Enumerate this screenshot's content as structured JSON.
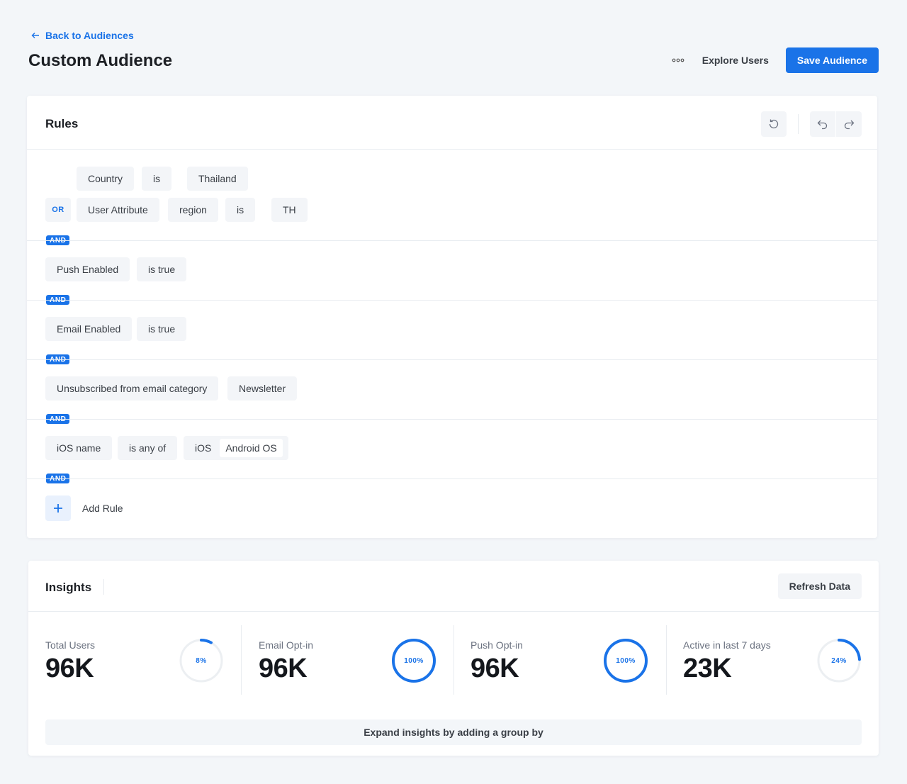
{
  "header": {
    "back_label": "Back to Audiences",
    "title": "Custom Audience",
    "explore_label": "Explore Users",
    "save_label": "Save Audience"
  },
  "rules": {
    "title": "Rules",
    "or_label": "OR",
    "and_label": "AND",
    "group1": {
      "row1": [
        "Country",
        "is",
        "Thailand"
      ],
      "row2": [
        "User Attribute",
        "region",
        "is",
        "TH"
      ]
    },
    "rule2": [
      "Push Enabled",
      "is true"
    ],
    "rule3": [
      "Email Enabled",
      "is true"
    ],
    "rule4": [
      "Unsubscribed from email category",
      "Newsletter"
    ],
    "rule5": {
      "field": "iOS name",
      "operator": "is any of",
      "values": [
        "iOS",
        "Android OS"
      ]
    },
    "add_rule_label": "Add Rule"
  },
  "insights": {
    "title": "Insights",
    "refresh_label": "Refresh Data",
    "stats": [
      {
        "label": "Total Users",
        "value": "96K",
        "percent_label": "8%",
        "percent": 8
      },
      {
        "label": "Email Opt-in",
        "value": "96K",
        "percent_label": "100%",
        "percent": 100
      },
      {
        "label": "Push Opt-in",
        "value": "96K",
        "percent_label": "100%",
        "percent": 100
      },
      {
        "label": "Active in last 7 days",
        "value": "23K",
        "percent_label": "24%",
        "percent": 24
      }
    ],
    "expand_label": "Expand insights by adding a group by"
  },
  "colors": {
    "accent": "#1a73e8",
    "ring_track": "#eceff2",
    "background": "#f3f6f9"
  }
}
